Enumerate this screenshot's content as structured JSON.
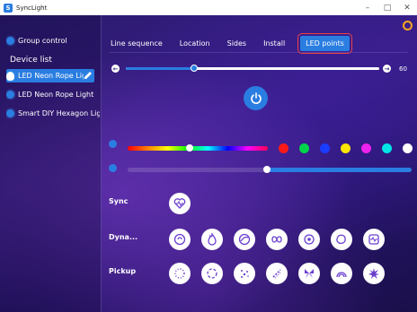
{
  "window": {
    "title": "SyncLight",
    "app_icon_glyph": "S"
  },
  "sidebar": {
    "group_control": "Group control",
    "device_list_heading": "Device list",
    "devices": [
      {
        "label": "LED Neon Rope Light",
        "selected": true
      },
      {
        "label": "LED Neon Rope Light",
        "selected": false
      },
      {
        "label": "Smart DIY Hexagon Light",
        "selected": false
      }
    ]
  },
  "tabs": [
    {
      "label": "Line sequence",
      "active": false
    },
    {
      "label": "Location",
      "active": false
    },
    {
      "label": "Sides",
      "active": false
    },
    {
      "label": "Install",
      "active": false
    },
    {
      "label": "LED points",
      "active": true
    }
  ],
  "speed": {
    "value": "60",
    "fraction": 0.27
  },
  "brightness": {
    "fraction": 0.49
  },
  "color": {
    "selected_fraction": 0.44,
    "swatches": [
      "#ff1a1a",
      "#00d44a",
      "#1a3cff",
      "#ffe600",
      "#ee22ee",
      "#00e5e5",
      "#ffffff"
    ]
  },
  "accent_color": "#2a7de1",
  "effect_rows": [
    {
      "label": "Sync",
      "icons": [
        "heart-pulse-icon"
      ]
    },
    {
      "label": "Dyna...",
      "icons": [
        "spiral-icon",
        "flame-icon",
        "swirl-icon",
        "infinity-icon",
        "target-icon",
        "blob-icon",
        "heartbeat-frame-icon"
      ]
    },
    {
      "label": "Pickup",
      "icons": [
        "dotted-ring-icon",
        "dashed-ring-icon",
        "sparkle-cluster-icon",
        "confetti-icon",
        "butterfly-icon",
        "rainbow-icon",
        "starburst-icon"
      ]
    }
  ]
}
